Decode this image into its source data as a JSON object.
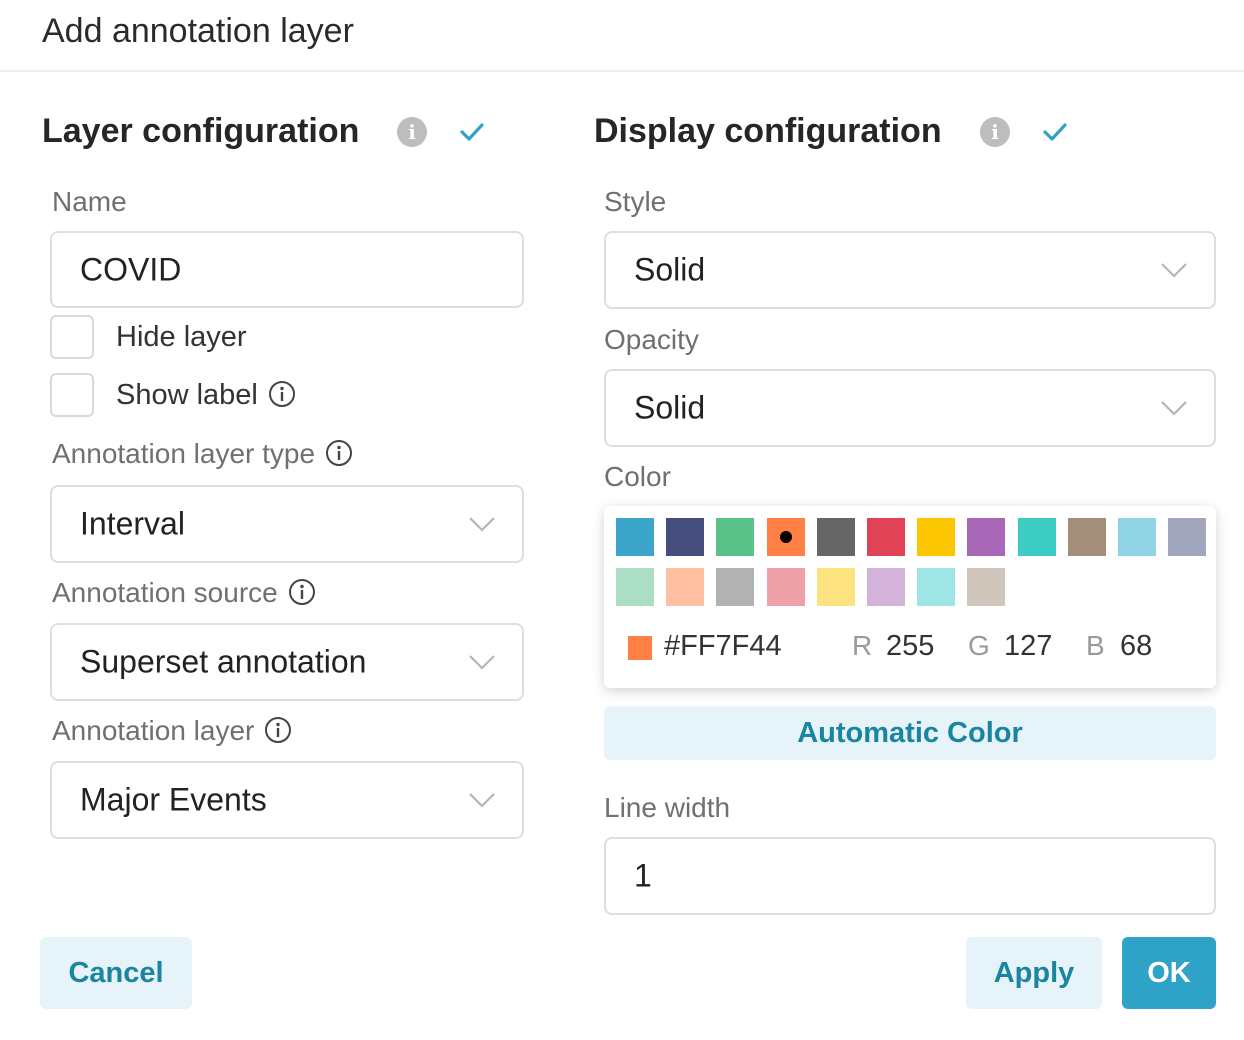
{
  "modal": {
    "title": "Add annotation layer"
  },
  "layer_config": {
    "title": "Layer configuration",
    "name_label": "Name",
    "name_value": "COVID",
    "hide_layer_label": "Hide layer",
    "show_label_label": "Show label",
    "type_label": "Annotation layer type",
    "type_value": "Interval",
    "source_label": "Annotation source",
    "source_value": "Superset annotation",
    "layer_label": "Annotation layer",
    "layer_value": "Major Events"
  },
  "display_config": {
    "title": "Display configuration",
    "style_label": "Style",
    "style_value": "Solid",
    "opacity_label": "Opacity",
    "opacity_value": "Solid",
    "color_label": "Color",
    "swatches": [
      "#3ba5ca",
      "#454e7c",
      "#5ac189",
      "#ff7f44",
      "#666666",
      "#e04355",
      "#fcc700",
      "#a868b7",
      "#3cccc4",
      "#a38f79",
      "#8fd3e4",
      "#a1a6bd",
      "#acdec5",
      "#fec0a1",
      "#b2b2b2",
      "#efa1aa",
      "#fde380",
      "#d3b3da",
      "#9ee5e5",
      "#d1c6bc"
    ],
    "hex_value": "#FF7F44",
    "r_label": "R",
    "r_value": "255",
    "g_label": "G",
    "g_value": "127",
    "b_label": "B",
    "b_value": "68",
    "auto_color_label": "Automatic Color",
    "line_width_label": "Line width",
    "line_width_value": "1"
  },
  "footer": {
    "cancel_label": "Cancel",
    "apply_label": "Apply",
    "ok_label": "OK"
  },
  "colors": {
    "accent": "#2fa3c7",
    "accent_text": "#1a85a0",
    "light_button": "#e6f3f8",
    "selected_color": "#ff7f44"
  }
}
